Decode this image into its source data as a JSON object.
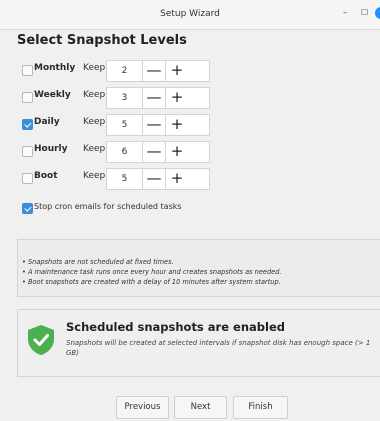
{
  "window": {
    "title": "Setup Wizard",
    "minimize_glyph": "–",
    "maximize_glyph": "☐"
  },
  "heading": "Select Snapshot Levels",
  "levels": [
    {
      "label": "Monthly",
      "checked": false,
      "keep_label": "Keep",
      "value": "2"
    },
    {
      "label": "Weekly",
      "checked": false,
      "keep_label": "Keep",
      "value": "3"
    },
    {
      "label": "Daily",
      "checked": true,
      "keep_label": "Keep",
      "value": "5"
    },
    {
      "label": "Hourly",
      "checked": false,
      "keep_label": "Keep",
      "value": "6"
    },
    {
      "label": "Boot",
      "checked": false,
      "keep_label": "Keep",
      "value": "5"
    }
  ],
  "stepper": {
    "minus_glyph": "—",
    "plus_glyph": "+"
  },
  "cron_option": {
    "label": "Stop cron emails for scheduled tasks",
    "checked": true
  },
  "notes": [
    "• Snapshots are not scheduled at fixed times.",
    "• A maintenance task runs once every hour and creates snapshots as needed.",
    "• Boot snapshots are created with a delay of 10 minutes after system startup."
  ],
  "status": {
    "title": "Scheduled snapshots are enabled",
    "description": "Snapshots will be created at selected intervals if snapshot disk has enough space (> 1 GB)",
    "icon": "shield-check-icon",
    "color": "#4caf50"
  },
  "buttons": {
    "previous": "Previous",
    "next": "Next",
    "finish": "Finish"
  },
  "colors": {
    "accent": "#3b8fd6"
  }
}
